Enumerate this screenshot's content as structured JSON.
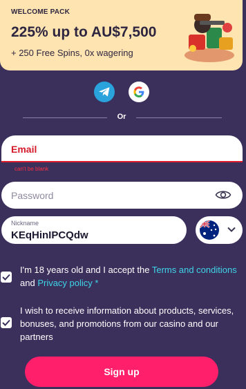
{
  "promo": {
    "tag": "WELCOME PACK",
    "title": "225% up to AU$7,500",
    "subtitle": "+ 250 Free Spins, 0x wagering"
  },
  "social": {
    "telegram_icon": "telegram-icon",
    "google_icon": "google-icon"
  },
  "divider": {
    "text": "Or"
  },
  "email": {
    "placeholder": "Email",
    "error": "can't be blank"
  },
  "password": {
    "placeholder": "Password"
  },
  "nickname": {
    "label": "Nickname",
    "value": "KEqHinIPCQdw"
  },
  "country": {
    "flag": "australia-flag-icon"
  },
  "consent": {
    "age_prefix": "I'm 18 years old and I accept the ",
    "terms_link": "Terms and conditions",
    "and": " and ",
    "privacy_link": "Privacy policy",
    "required_mark": " *",
    "marketing": "I wish to receive information about products, services, bonuses, and promotions from our casino and our partners"
  },
  "signup": {
    "label": "Sign up"
  },
  "colors": {
    "background": "#3b2f5c",
    "promo": "#fde4b0",
    "accent": "#ff1f6a",
    "link": "#3fd5e8",
    "error": "#e01e2e"
  }
}
